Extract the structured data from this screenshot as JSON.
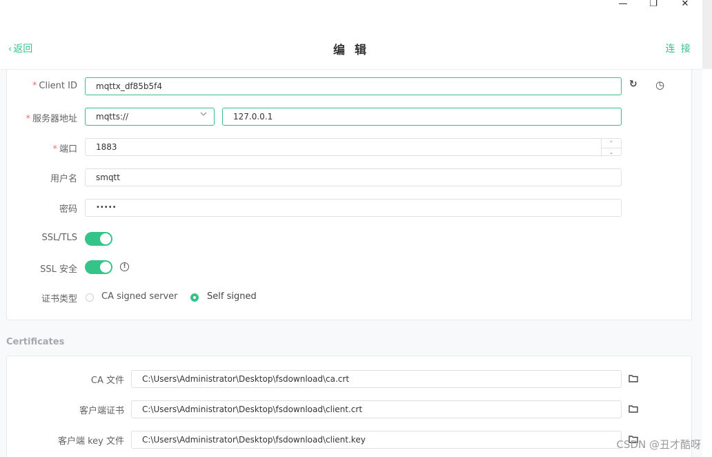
{
  "window": {
    "minimize": "—",
    "restore": "❐",
    "close": "✕"
  },
  "header": {
    "back_label": "返回",
    "back_chevron": "‹",
    "title": "编 辑",
    "connect_label": "连 接"
  },
  "form": {
    "client_id": {
      "label": "Client ID",
      "required": "*",
      "value": "mqttx_df85b5f4",
      "refresh_icon": "↻",
      "history_icon": "◷"
    },
    "host": {
      "label": "服务器地址",
      "required": "*",
      "protocol": "mqtts://",
      "value": "127.0.0.1"
    },
    "port": {
      "label": "端口",
      "required": "*",
      "value": "1883",
      "up": "⌃",
      "down": "⌄"
    },
    "username": {
      "label": "用户名",
      "value": "smqtt"
    },
    "password": {
      "label": "密码",
      "value": "•••••"
    },
    "ssl_tls": {
      "label": "SSL/TLS",
      "enabled": true
    },
    "ssl_secure": {
      "label": "SSL 安全",
      "enabled": true,
      "info": "!"
    },
    "cert_type": {
      "label": "证书类型",
      "options": [
        "CA signed server",
        "Self signed"
      ],
      "selected": "Self signed"
    }
  },
  "certificates": {
    "section_title": "Certificates",
    "ca_file": {
      "label": "CA 文件",
      "value": "C:\\Users\\Administrator\\Desktop\\fsdownload\\ca.crt"
    },
    "client_cert": {
      "label": "客户端证书",
      "value": "C:\\Users\\Administrator\\Desktop\\fsdownload\\client.crt"
    },
    "client_key": {
      "label": "客户端 key 文件",
      "value": "C:\\Users\\Administrator\\Desktop\\fsdownload\\client.key"
    }
  },
  "watermark": "CSDN @丑才酷呀",
  "colors": {
    "accent": "#34c388",
    "required": "#f56c6c",
    "section_title": "#a2a9b0"
  }
}
